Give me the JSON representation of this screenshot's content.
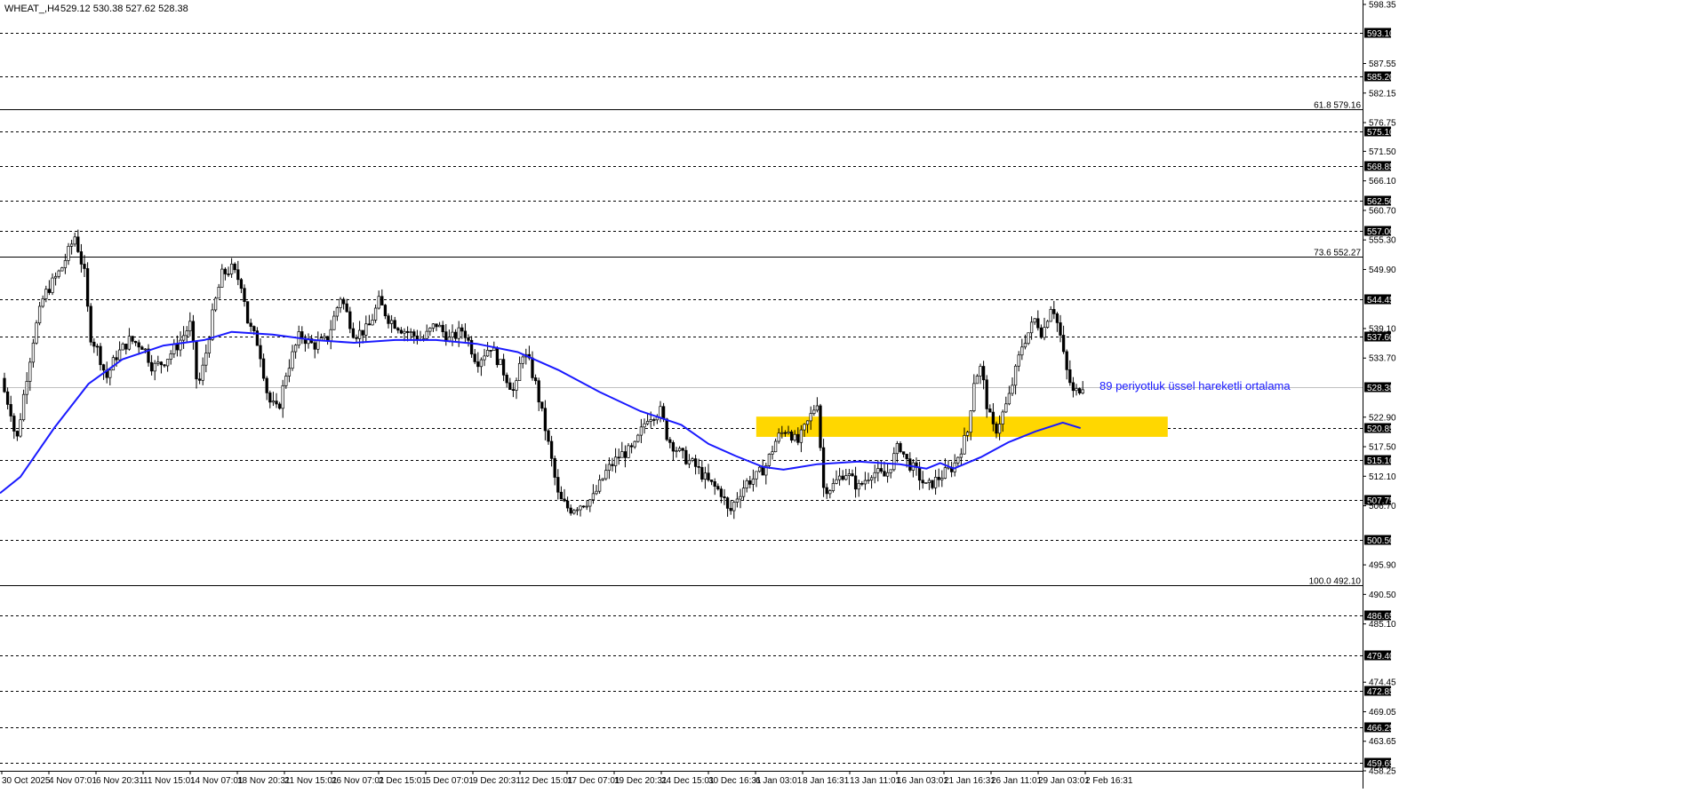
{
  "header": {
    "symbol": "WHEAT_,H4",
    "ohlc": "529.12 530.38 527.62 528.38"
  },
  "chart_data": {
    "type": "candlestick",
    "timeframe": "H4",
    "ylim": [
      458.25,
      598.35
    ],
    "price_ticks": [
      "598.35",
      "587.55",
      "582.15",
      "576.75",
      "571.50",
      "566.10",
      "560.70",
      "555.30",
      "549.90",
      "539.10",
      "533.70",
      "522.90",
      "517.50",
      "512.10",
      "506.70",
      "495.90",
      "490.50",
      "485.10",
      "474.45",
      "469.05",
      "463.65",
      "458.25"
    ],
    "time_labels": [
      "30 Oct 2025",
      "4 Nov 07:01",
      "6 Nov 20:31",
      "11 Nov 15:01",
      "14 Nov 07:01",
      "18 Nov 20:31",
      "21 Nov 15:01",
      "26 Nov 07:01",
      "2 Dec 15:01",
      "5 Dec 07:01",
      "9 Dec 20:31",
      "12 Dec 15:01",
      "17 Dec 07:01",
      "19 Dec 20:31",
      "24 Dec 15:01",
      "30 Dec 16:31",
      "6 Jan 03:01",
      "8 Jan 16:31",
      "13 Jan 11:01",
      "16 Jan 03:01",
      "21 Jan 16:31",
      "26 Jan 11:01",
      "29 Jan 03:01",
      "2 Feb 16:31"
    ],
    "horizontal_levels": [
      {
        "value": 593.1,
        "label": "593.10",
        "style": "dashed"
      },
      {
        "value": 585.2,
        "label": "585.20",
        "style": "dashed"
      },
      {
        "value": 575.1,
        "label": "575.10",
        "style": "dashed"
      },
      {
        "value": 568.85,
        "label": "568.85",
        "style": "dashed"
      },
      {
        "value": 562.5,
        "label": "562.50",
        "style": "dashed"
      },
      {
        "value": 557.0,
        "label": "557.00",
        "style": "dashed"
      },
      {
        "value": 544.45,
        "label": "544.45",
        "style": "dashed"
      },
      {
        "value": 537.6,
        "label": "537.60",
        "style": "dashed"
      },
      {
        "value": 520.85,
        "label": "520.85",
        "style": "dashed"
      },
      {
        "value": 515.1,
        "label": "515.10",
        "style": "dashed"
      },
      {
        "value": 507.75,
        "label": "507.75",
        "style": "dashed"
      },
      {
        "value": 500.5,
        "label": "500.50",
        "style": "dashed"
      },
      {
        "value": 486.65,
        "label": "486.65",
        "style": "dashed"
      },
      {
        "value": 479.4,
        "label": "479.40",
        "style": "dashed"
      },
      {
        "value": 472.85,
        "label": "472.85",
        "style": "dashed"
      },
      {
        "value": 466.25,
        "label": "466.25",
        "style": "dashed"
      },
      {
        "value": 459.65,
        "label": "459.65",
        "style": "dashed"
      }
    ],
    "fib_levels": [
      {
        "value": 579.16,
        "label": "61.8 579.16"
      },
      {
        "value": 552.27,
        "label": "73.6 552.27"
      },
      {
        "value": 492.1,
        "label": "100.0 492.10"
      }
    ],
    "current_price": {
      "value": 528.38,
      "label": "528.38"
    },
    "zone": {
      "y_from": 519.3,
      "y_to": 523.0,
      "x_from": 0.555,
      "x_to": 0.857,
      "color": "#ffd700"
    },
    "ema": {
      "period": 89,
      "color": "#1a1aff",
      "label": "89 periyotluk üssel hareketli ortalama",
      "points": [
        [
          0,
          509.0
        ],
        [
          0.015,
          512.0
        ],
        [
          0.04,
          521.0
        ],
        [
          0.065,
          529.0
        ],
        [
          0.09,
          533.5
        ],
        [
          0.12,
          536.0
        ],
        [
          0.15,
          537.0
        ],
        [
          0.17,
          538.5
        ],
        [
          0.2,
          538.0
        ],
        [
          0.23,
          537.0
        ],
        [
          0.26,
          536.5
        ],
        [
          0.29,
          537.0
        ],
        [
          0.32,
          537.0
        ],
        [
          0.35,
          536.3
        ],
        [
          0.38,
          534.8
        ],
        [
          0.41,
          531.5
        ],
        [
          0.44,
          527.5
        ],
        [
          0.47,
          524.0
        ],
        [
          0.5,
          521.5
        ],
        [
          0.52,
          518.0
        ],
        [
          0.54,
          515.8
        ],
        [
          0.56,
          513.8
        ],
        [
          0.575,
          513.3
        ],
        [
          0.6,
          514.3
        ],
        [
          0.63,
          514.8
        ],
        [
          0.66,
          514.3
        ],
        [
          0.68,
          513.5
        ],
        [
          0.69,
          514.5
        ],
        [
          0.7,
          513.5
        ],
        [
          0.72,
          515.6
        ],
        [
          0.74,
          518.3
        ],
        [
          0.76,
          520.3
        ],
        [
          0.78,
          521.9
        ],
        [
          0.793,
          520.9
        ]
      ]
    },
    "price_path": [
      [
        0,
        530.0
      ],
      [
        0.008,
        524.0
      ],
      [
        0.012,
        518.0
      ],
      [
        0.018,
        528.0
      ],
      [
        0.025,
        538.0
      ],
      [
        0.032,
        545.0
      ],
      [
        0.045,
        550.0
      ],
      [
        0.055,
        556.0
      ],
      [
        0.062,
        549.0
      ],
      [
        0.066,
        538.0
      ],
      [
        0.072,
        535.0
      ],
      [
        0.078,
        530.0
      ],
      [
        0.085,
        534.0
      ],
      [
        0.095,
        537.0
      ],
      [
        0.105,
        536.0
      ],
      [
        0.112,
        532.0
      ],
      [
        0.12,
        533.0
      ],
      [
        0.13,
        536.0
      ],
      [
        0.14,
        540.0
      ],
      [
        0.145,
        528.0
      ],
      [
        0.15,
        533.0
      ],
      [
        0.157,
        543.0
      ],
      [
        0.163,
        549.0
      ],
      [
        0.17,
        550.0
      ],
      [
        0.178,
        547.0
      ],
      [
        0.182,
        540.0
      ],
      [
        0.19,
        536.0
      ],
      [
        0.197,
        526.0
      ],
      [
        0.204,
        524.0
      ],
      [
        0.21,
        531.0
      ],
      [
        0.22,
        538.0
      ],
      [
        0.23,
        536.0
      ],
      [
        0.24,
        537.0
      ],
      [
        0.25,
        545.0
      ],
      [
        0.26,
        538.0
      ],
      [
        0.27,
        539.0
      ],
      [
        0.278,
        544.0
      ],
      [
        0.285,
        541.0
      ],
      [
        0.295,
        539.0
      ],
      [
        0.31,
        537.0
      ],
      [
        0.32,
        540.0
      ],
      [
        0.33,
        537.0
      ],
      [
        0.34,
        539.0
      ],
      [
        0.35,
        533.0
      ],
      [
        0.36,
        536.0
      ],
      [
        0.37,
        531.0
      ],
      [
        0.378,
        527.0
      ],
      [
        0.383,
        535.0
      ],
      [
        0.388,
        533.0
      ],
      [
        0.393,
        529.0
      ],
      [
        0.4,
        521.0
      ],
      [
        0.404,
        516.0
      ],
      [
        0.41,
        508.0
      ],
      [
        0.418,
        506.0
      ],
      [
        0.426,
        507.0
      ],
      [
        0.435,
        508.0
      ],
      [
        0.445,
        513.0
      ],
      [
        0.455,
        516.0
      ],
      [
        0.465,
        517.0
      ],
      [
        0.475,
        523.0
      ],
      [
        0.485,
        524.0
      ],
      [
        0.49,
        519.0
      ],
      [
        0.5,
        516.0
      ],
      [
        0.51,
        514.0
      ],
      [
        0.52,
        511.0
      ],
      [
        0.53,
        509.0
      ],
      [
        0.535,
        505.0
      ],
      [
        0.54,
        508.0
      ],
      [
        0.548,
        511.0
      ],
      [
        0.555,
        512.0
      ],
      [
        0.562,
        514.0
      ],
      [
        0.57,
        519.0
      ],
      [
        0.578,
        521.0
      ],
      [
        0.585,
        518.0
      ],
      [
        0.593,
        522.0
      ],
      [
        0.6,
        526.0
      ],
      [
        0.604,
        510.0
      ],
      [
        0.61,
        510.0
      ],
      [
        0.62,
        513.0
      ],
      [
        0.63,
        510.0
      ],
      [
        0.64,
        513.0
      ],
      [
        0.65,
        512.0
      ],
      [
        0.66,
        518.0
      ],
      [
        0.665,
        515.0
      ],
      [
        0.672,
        513.0
      ],
      [
        0.68,
        510.0
      ],
      [
        0.69,
        512.0
      ],
      [
        0.7,
        514.0
      ],
      [
        0.71,
        520.0
      ],
      [
        0.715,
        530.0
      ],
      [
        0.72,
        532.0
      ],
      [
        0.725,
        524.0
      ],
      [
        0.73,
        520.0
      ],
      [
        0.74,
        526.0
      ],
      [
        0.75,
        536.0
      ],
      [
        0.76,
        541.0
      ],
      [
        0.765,
        538.0
      ],
      [
        0.772,
        544.0
      ],
      [
        0.778,
        538.0
      ],
      [
        0.782,
        532.0
      ],
      [
        0.788,
        527.0
      ],
      [
        0.795,
        529.0
      ]
    ],
    "colors": {
      "grid_dashed": "#000000",
      "ema": "#1a1aff",
      "zone": "#ffd700",
      "candles": "#000000",
      "background": "#ffffff"
    }
  }
}
